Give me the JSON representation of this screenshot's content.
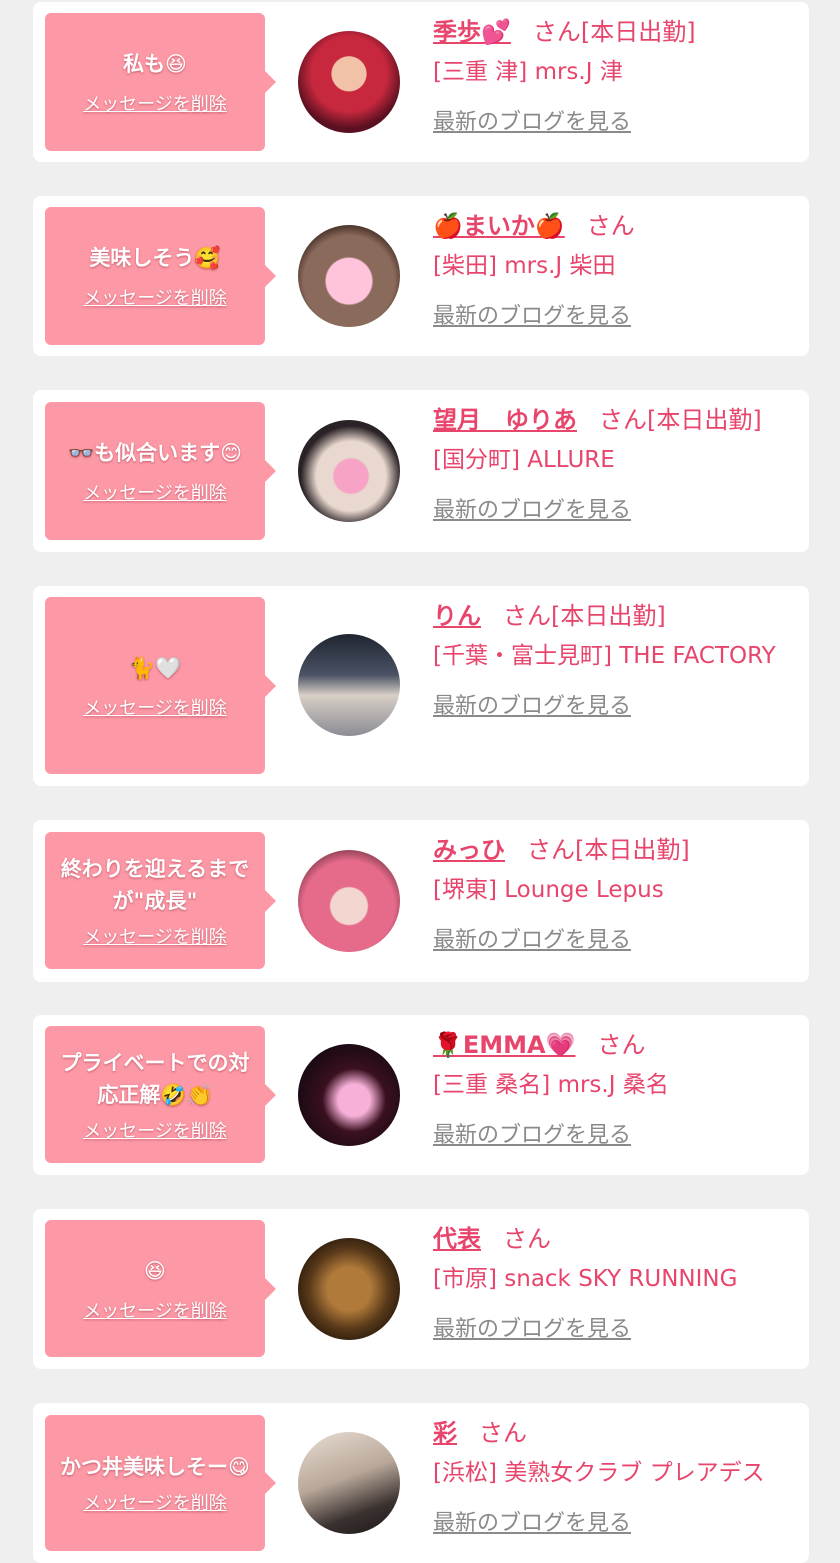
{
  "colors": {
    "page_bg": "#efefef",
    "card_bg": "#ffffff",
    "bubble": "#fd99a6",
    "accent": "#e8456c",
    "link_gray": "#8a8a8a"
  },
  "delete_label": "メッセージを削除",
  "blog_label": "最新のブログを見る",
  "items": [
    {
      "message": "私も😆",
      "name": "季歩💕",
      "suffix": "さん[本日出勤]",
      "shop": "[三重 津] mrs.J 津"
    },
    {
      "message": "美味しそう🥰",
      "name": "🍎まいか🍎",
      "suffix": "さん",
      "shop": "[柴田] mrs.J 柴田"
    },
    {
      "message": "👓も似合います😊",
      "name": "望月　ゆりあ",
      "suffix": "さん[本日出勤]",
      "shop": "[国分町] ALLURE"
    },
    {
      "message": "🐈🤍",
      "name": "りん",
      "suffix": "さん[本日出勤]",
      "shop": "[千葉・富士見町] THE FACTORY"
    },
    {
      "message": "終わりを迎えるまでが\"成長\"",
      "name": "みっひ",
      "suffix": "さん[本日出勤]",
      "shop": "[堺東] Lounge Lepus"
    },
    {
      "message": "プライベートでの対応正解🤣👏",
      "name": "🌹EMMA💗",
      "suffix": "さん",
      "shop": "[三重 桑名] mrs.J 桑名"
    },
    {
      "message": "😆",
      "name": "代表",
      "suffix": "さん",
      "shop": "[市原] snack SKY RUNNING"
    },
    {
      "message": "かつ丼美味しそー😋",
      "name": "彩",
      "suffix": "さん",
      "shop": "[浜松] 美熟女クラブ プレアデス"
    }
  ]
}
